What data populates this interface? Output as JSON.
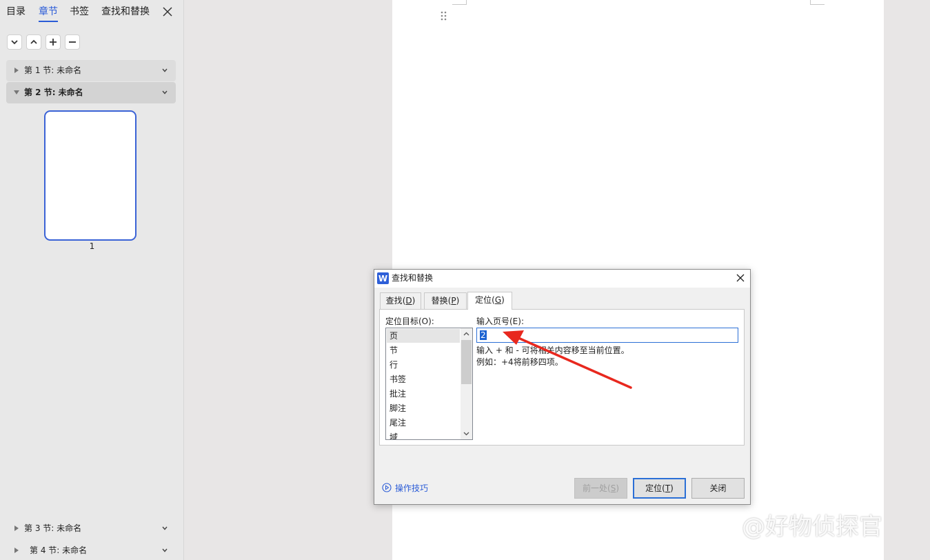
{
  "nav": {
    "tabs": [
      "目录",
      "章节",
      "书签",
      "查找和替换"
    ],
    "active_tab": "章节",
    "sections": [
      {
        "label": "第 1 节: 未命名"
      },
      {
        "label": "第 2 节: 未命名"
      },
      {
        "label": "第 3 节: 未命名"
      },
      {
        "label": "第 4 节: 未命名"
      }
    ],
    "thumbnail_page": "1"
  },
  "dialog": {
    "title": "查找和替换",
    "logo": "W",
    "tabs": [
      {
        "text": "查找",
        "key": "D"
      },
      {
        "text": "替换",
        "key": "P"
      },
      {
        "text": "定位",
        "key": "G"
      }
    ],
    "target_label": "定位目标(O):",
    "target_items": [
      "页",
      "节",
      "行",
      "书签",
      "批注",
      "脚注",
      "尾注",
      "域"
    ],
    "selected_target": "页",
    "page_label": "输入页号(E):",
    "page_value": "2",
    "hint1": "输入 + 和 - 可将相关内容移至当前位置。",
    "hint2": "例如：+4将前移四项。",
    "tips": "操作技巧",
    "btn_prev": {
      "text": "前一处",
      "key": "S"
    },
    "btn_goto": {
      "text": "定位",
      "key": "T"
    },
    "btn_close": "关闭"
  },
  "watermark": "@好物侦探官",
  "colors": {
    "accent": "#2a5bd7",
    "annotation_arrow": "#e8281e"
  }
}
